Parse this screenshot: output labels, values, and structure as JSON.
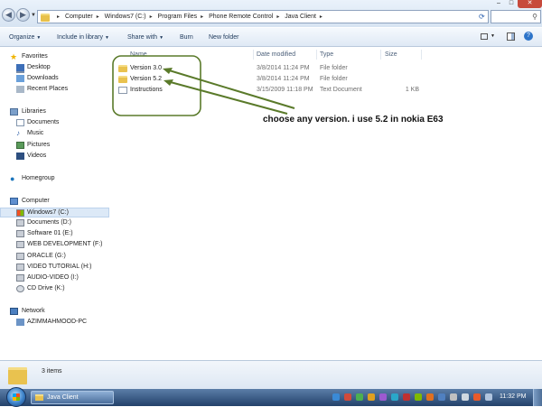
{
  "address": {
    "crumbs": [
      "Computer",
      "Windows7 (C:)",
      "Program Files",
      "Phone Remote Control",
      "Java Client"
    ]
  },
  "window_controls": {
    "minimize": "–",
    "maximize": "□",
    "close": "✕"
  },
  "toolbar": {
    "organize": "Organize",
    "include_in_library": "Include in library",
    "share_with": "Share with",
    "burn": "Burn",
    "new_folder": "New folder"
  },
  "nav": {
    "favorites": {
      "label": "Favorites",
      "items": [
        "Desktop",
        "Downloads",
        "Recent Places"
      ]
    },
    "libraries": {
      "label": "Libraries",
      "items": [
        "Documents",
        "Music",
        "Pictures",
        "Videos"
      ]
    },
    "homegroup": "Homegroup",
    "computer": {
      "label": "Computer",
      "items": [
        "Windows7 (C:)",
        "Documents (D:)",
        "Software 01 (E:)",
        "WEB DEVELOPMENT (F:)",
        "ORACLE (G:)",
        "VIDEO TUTORIAL (H:)",
        "AUDIO-VIDEO (I:)",
        "CD Drive (K:)"
      ]
    },
    "network": {
      "label": "Network",
      "items": [
        "AZIMMAHMOOD-PC"
      ]
    }
  },
  "columns": {
    "name": "Name",
    "date_modified": "Date modified",
    "type": "Type",
    "size": "Size"
  },
  "files": [
    {
      "name": "Version 3.0",
      "date": "3/8/2014 11:24 PM",
      "type": "File folder",
      "size": "",
      "icon": "folder-icon"
    },
    {
      "name": "Version 5.2",
      "date": "3/8/2014 11:24 PM",
      "type": "File folder",
      "size": "",
      "icon": "folder-icon"
    },
    {
      "name": "Instructions",
      "date": "3/15/2009 11:18 PM",
      "type": "Text Document",
      "size": "1 KB",
      "icon": "text-file-icon"
    }
  ],
  "annotation": {
    "text": "choose any version. i use 5.2 in nokia E63",
    "color": "#5a7a2a"
  },
  "details": {
    "count": "3 items"
  },
  "taskbar": {
    "window_title": "Java Client",
    "clock": "11:32 PM"
  },
  "colors": {
    "accent": "#2a60b0",
    "annotation_green": "#5a7a2a",
    "taskbar": "#23416a"
  }
}
